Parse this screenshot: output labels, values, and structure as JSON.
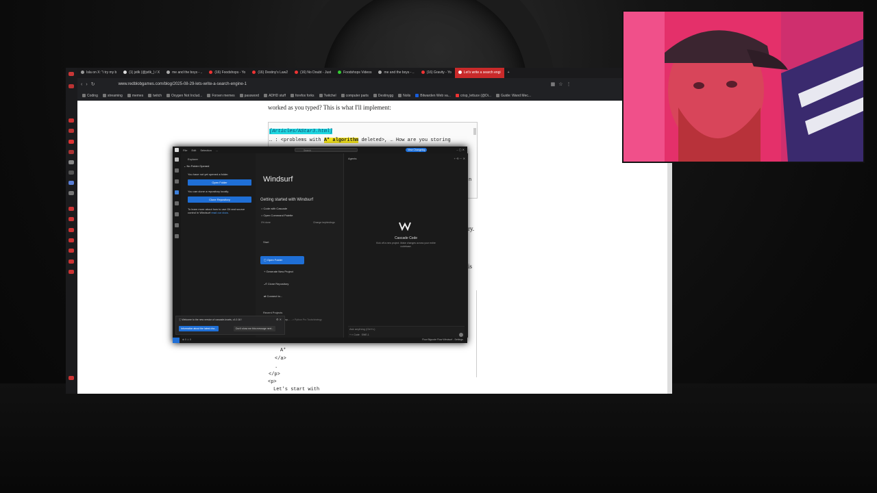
{
  "browser": {
    "tabs": [
      {
        "label": "Isla on X: \"i try my b",
        "active": false
      },
      {
        "label": "(1) jstlk (@jstlk_) / X",
        "active": false
      },
      {
        "label": "me and the boys - ..",
        "active": false
      },
      {
        "label": "(16) Foodshops - Yo",
        "active": false
      },
      {
        "label": "(16) Destiny's Law2",
        "active": false
      },
      {
        "label": "(16) No Doubt - Just",
        "active": false
      },
      {
        "label": "Foodshops Videos",
        "active": false
      },
      {
        "label": "me and the boys - ..",
        "active": false
      },
      {
        "label": "(16) Gravity - Yo",
        "active": false
      },
      {
        "label": "Let's write a search engi",
        "active": true
      }
    ],
    "url": "www.redblobgames.com/blog/2025-08-29-lets-write-a-search-engine-1",
    "bookmarks": [
      "Coding",
      "streaming",
      "memes",
      "twitch",
      "Oxygen Not Includ...",
      "Forsen memes",
      "password",
      "ADHD stuff",
      "forefox forks",
      "Twitchel",
      "computer parts",
      "Destinygg",
      "Nolis",
      "Bitwarden Web va...",
      "crisp_lettuce (@Di...",
      "Guide: Wand Mec..."
    ]
  },
  "article": {
    "line_top": "worked as you typed? This is what I'll implement:",
    "code_file": "[Articles/AStar3.html]",
    "code_pre": "… : <problems with ",
    "code_highlight": "A* algorithm",
    "code_post": " deleted>, … How are you storing",
    "frag_n": "n",
    "frag_ry": "ry.",
    "frag_is": "is",
    "code_lines": [
      "<a href=\"…\">",
      "A*",
      "</a>",
      ".",
      "</p>",
      "<p>",
      "Let's start with"
    ]
  },
  "windsurf": {
    "menu": [
      "File",
      "Edit",
      "Selection",
      "..."
    ],
    "search_placeholder": "Search",
    "view_changelog": "View Changelog",
    "explorer_title": "Explorer",
    "no_folder": "No Folder Opened",
    "no_folder_msg": "You have not yet opened a folder.",
    "open_folder_btn": "Open Folder",
    "clone_msg": "You can clone a repository locally.",
    "clone_btn": "Clone Repository",
    "learn_msg": "To learn more about how to use Git and source control in Windsurf",
    "learn_link": "read our docs.",
    "welcome_title": "Windsurf",
    "getting_started": "Getting started with Windsurf",
    "gs_items": [
      "Code with Cascade",
      "Open Command Palette"
    ],
    "progress": "0% done",
    "change_keybindings": "Change keybindings",
    "start_heading": "Start",
    "start_items": [
      "Open Folder",
      "Generate New Project",
      "Clone Repository",
      "Connect to..."
    ],
    "recent_heading": "Recent Projects",
    "recent_item": "Web Development Rep...",
    "recent_path": "...> Python Pro Tools/strategy",
    "agents_label": "Agents",
    "cascade_title": "Cascade Code",
    "cascade_sub": "Kick off a new project. Make changes across your entire codebase.",
    "ask_placeholder": "Ask anything (Ctrl+L)",
    "code_mode": "Code",
    "model": "SWE-1",
    "notif_text": "Welcome to the new version of cascade-kvarts, v1.0.16 !",
    "notif_btn1": "Information about the latest cha...",
    "notif_btn2": "Don't show me this message next...",
    "status_left": "⊗ 0 ⚠ 0",
    "status_right": "Flow  Bigcode Flow  Windsurf - Settings"
  },
  "colors": {
    "accent": "#1f6fd6",
    "highlight_yellow": "#f4e41c",
    "highlight_cyan": "#21d6e0",
    "active_tab": "#c92a2a",
    "webcam": "#e02a5f"
  }
}
